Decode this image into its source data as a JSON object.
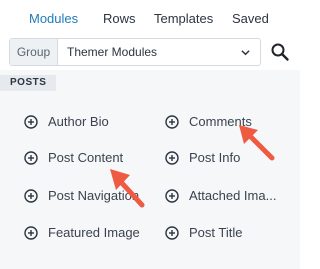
{
  "tabs": [
    {
      "label": "Modules",
      "active": true
    },
    {
      "label": "Rows",
      "active": false
    },
    {
      "label": "Templates",
      "active": false
    },
    {
      "label": "Saved",
      "active": false
    }
  ],
  "group_select": {
    "label": "Group",
    "value": "Themer Modules"
  },
  "section": {
    "label": "POSTS"
  },
  "modules": [
    {
      "label": "Author Bio"
    },
    {
      "label": "Comments"
    },
    {
      "label": "Post Content"
    },
    {
      "label": "Post Info"
    },
    {
      "label": "Post Navigation"
    },
    {
      "label": "Attached Ima..."
    },
    {
      "label": "Featured Image"
    },
    {
      "label": "Post Title"
    }
  ],
  "icons": {
    "search": "search-icon",
    "dropdown": "chevron-down-icon",
    "add": "plus-circle-icon",
    "annotation": "arrow-annotation"
  },
  "colors": {
    "active_tab": "#1f7cb8",
    "annotation_arrow": "#ef5a43",
    "panel_bg": "#f5f7f9"
  }
}
